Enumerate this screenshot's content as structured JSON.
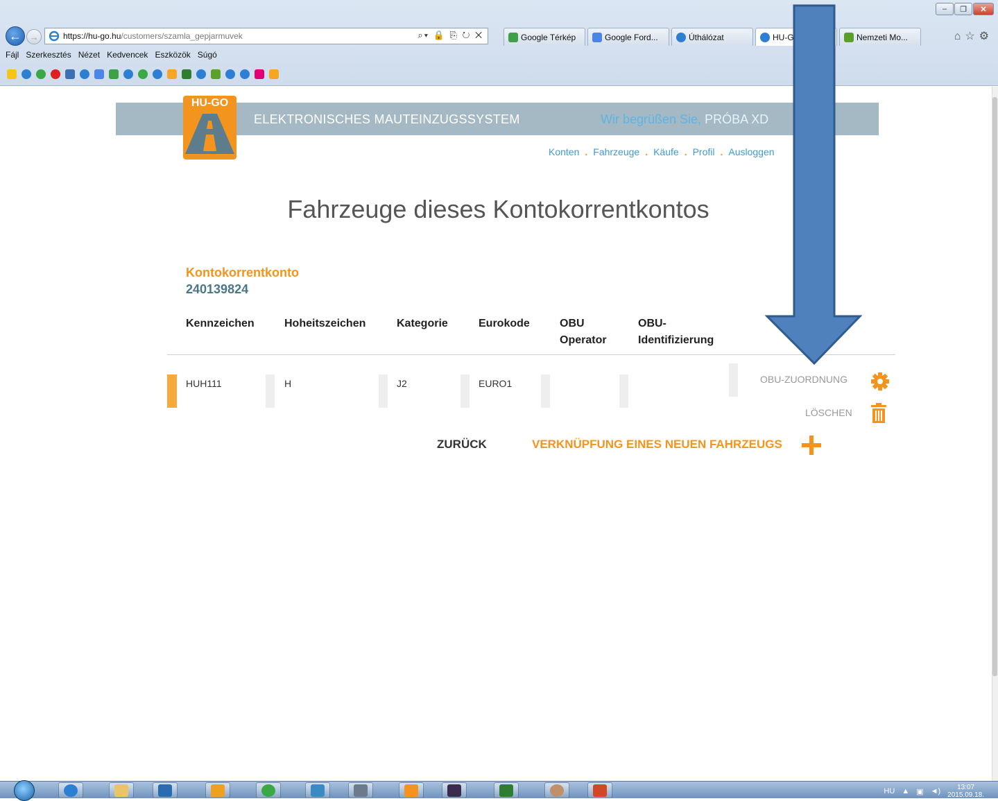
{
  "browser": {
    "url_domain": "https://hu-go.hu",
    "url_path": "/customers/szamla_gepjarmuvek",
    "tabs": [
      "Google Térkép",
      "Google Ford...",
      "Úthálózat",
      "HU-GO",
      "Nemzeti Mo..."
    ],
    "menu": [
      "Fájl",
      "Szerkesztés",
      "Nézet",
      "Kedvencek",
      "Eszközök",
      "Súgó"
    ]
  },
  "site": {
    "logo_text": "HU-GO",
    "system_title": "ELEKTRONISCHES MAUTEINZUGSSYSTEM",
    "greeting_lead": "Wir begrüßen Sie,",
    "greeting_name": "PRÓBA XD",
    "nav": [
      "Konten",
      "Fahrzeuge",
      "Käufe",
      "Profil",
      "Ausloggen"
    ]
  },
  "page": {
    "title": "Fahrzeuge dieses Kontokorrentkontos",
    "account_label": "Kontokorrentkonto",
    "account_number": "240139824"
  },
  "table": {
    "headers": {
      "plate": "Kennzeichen",
      "country": "Hoheitszeichen",
      "category": "Kategorie",
      "eurocode": "Eurokode",
      "obu_operator": "OBU Operator",
      "obu_id": "OBU- Identifizierung"
    },
    "rows": [
      {
        "plate": "HUH111",
        "country": "H",
        "category": "J2",
        "eurocode": "EURO1",
        "obu_operator": "",
        "obu_id": ""
      }
    ],
    "actions": {
      "assign": "OBU-ZUORDNUNG",
      "delete": "LÖSCHEN"
    }
  },
  "buttons": {
    "back": "ZURÜCK",
    "add_vehicle": "VERKNÜPFUNG EINES NEUEN FAHRZEUGS"
  },
  "tray": {
    "lang": "HU",
    "time": "13:07",
    "date": "2015.09.18."
  },
  "colors": {
    "accent": "#f2941d",
    "header": "#a4b9c3",
    "link": "#3d9bd6",
    "arrow": "#4f81bd"
  }
}
